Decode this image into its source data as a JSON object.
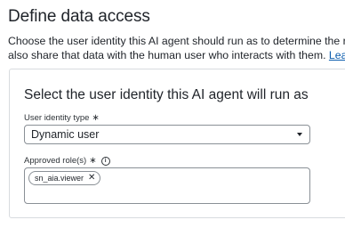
{
  "header": {
    "title": "Define data access",
    "description_line1": "Choose the user identity this AI agent should run as to determine the roles an",
    "description_line2": "also share that data with the human user who interacts with them. ",
    "learn_more_link": "Learn more"
  },
  "card": {
    "title": "Select the user identity this AI agent will run as",
    "user_identity_type": {
      "label": "User identity type",
      "required_marker": "∗",
      "value": "Dynamic user"
    },
    "approved_roles": {
      "label": "Approved role(s)",
      "required_marker": "∗",
      "info_glyph": "i",
      "chips": [
        {
          "label": "sn_aia.viewer",
          "remove_glyph": "✕"
        }
      ]
    }
  },
  "icons": {
    "required": "asterisk-icon",
    "info": "info-icon",
    "dropdown": "caret-down-icon",
    "chip_remove": "close-icon"
  },
  "colors": {
    "link": "#0b5cad",
    "text": "#1f2329",
    "border": "#8a9096",
    "card_border": "#d8dbdf"
  }
}
